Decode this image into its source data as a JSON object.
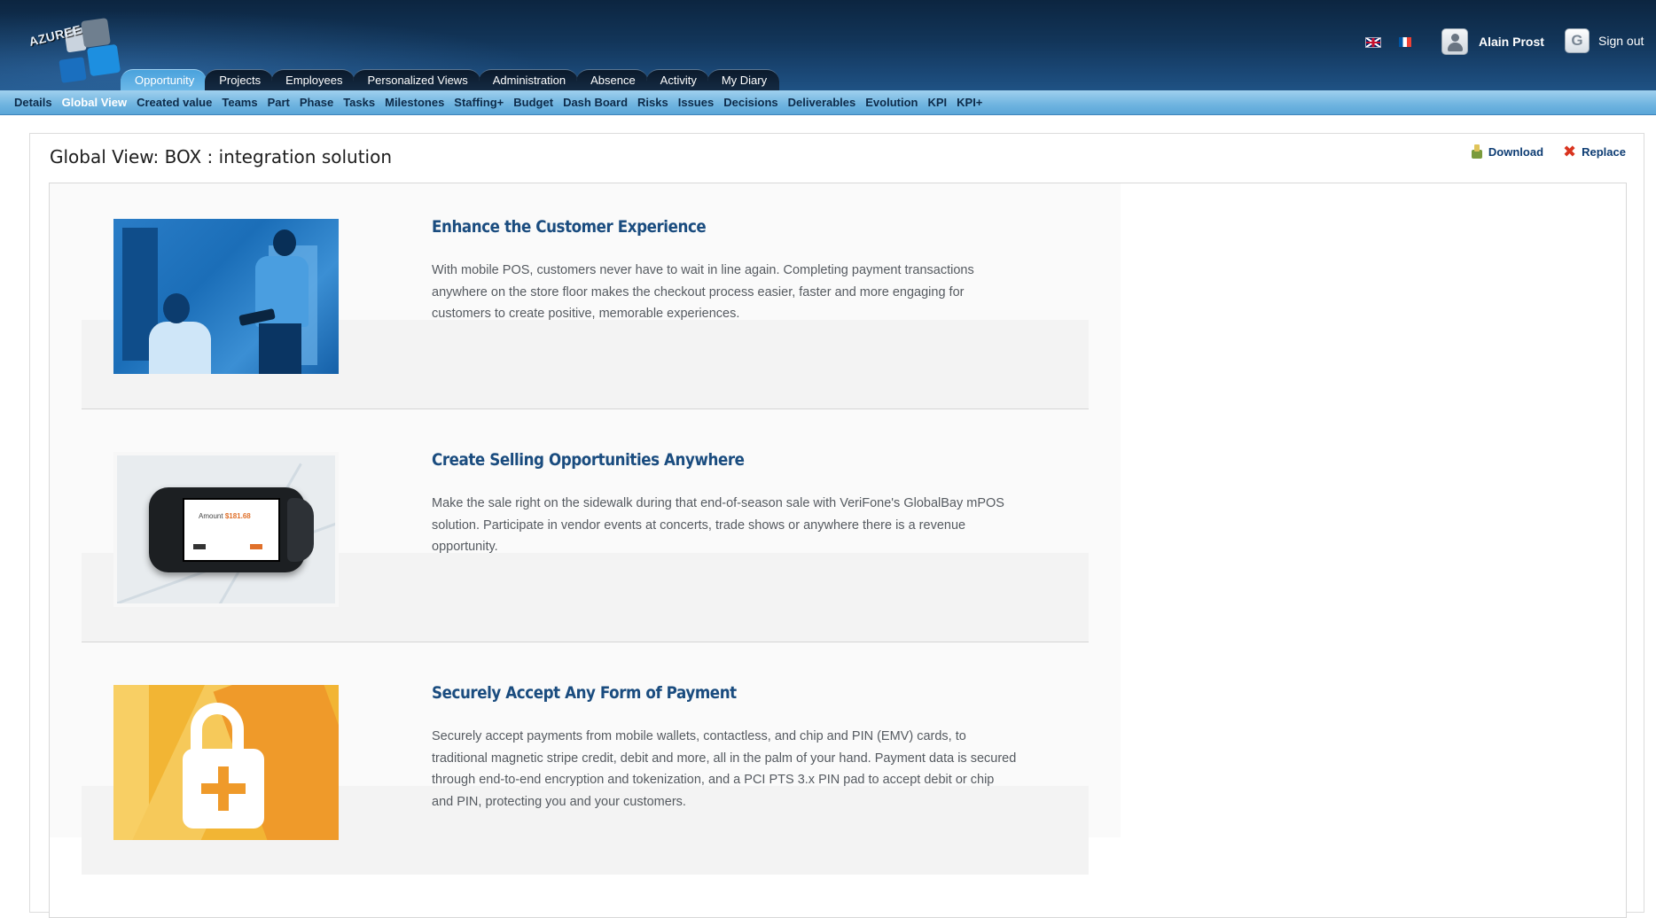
{
  "brand": {
    "logo_text": "AZUREE"
  },
  "header": {
    "languages": [
      {
        "code": "en",
        "icon": "uk-flag-icon"
      },
      {
        "code": "fr",
        "icon": "fr-flag-icon"
      }
    ],
    "user_name": "Alain Prost",
    "sign_out_label": "Sign out"
  },
  "main_tabs": [
    {
      "label": "Opportunity",
      "active": true
    },
    {
      "label": "Projects",
      "active": false
    },
    {
      "label": "Employees",
      "active": false
    },
    {
      "label": "Personalized Views",
      "active": false
    },
    {
      "label": "Administration",
      "active": false
    },
    {
      "label": "Absence",
      "active": false
    },
    {
      "label": "Activity",
      "active": false
    },
    {
      "label": "My Diary",
      "active": false
    }
  ],
  "sub_nav": [
    {
      "label": "Details",
      "active": false
    },
    {
      "label": "Global View",
      "active": true
    },
    {
      "label": "Created value",
      "active": false
    },
    {
      "label": "Teams",
      "active": false
    },
    {
      "label": "Part",
      "active": false
    },
    {
      "label": "Phase",
      "active": false
    },
    {
      "label": "Tasks",
      "active": false
    },
    {
      "label": "Milestones",
      "active": false
    },
    {
      "label": "Staffing+",
      "active": false
    },
    {
      "label": "Budget",
      "active": false
    },
    {
      "label": "Dash Board",
      "active": false
    },
    {
      "label": "Risks",
      "active": false
    },
    {
      "label": "Issues",
      "active": false
    },
    {
      "label": "Decisions",
      "active": false
    },
    {
      "label": "Deliverables",
      "active": false
    },
    {
      "label": "Evolution",
      "active": false
    },
    {
      "label": "KPI",
      "active": false
    },
    {
      "label": "KPI+",
      "active": false
    }
  ],
  "panel": {
    "title": "Global View: BOX : integration solution",
    "download_label": "Download",
    "replace_label": "Replace"
  },
  "features": [
    {
      "title": "Enhance the Customer Experience",
      "text": "With mobile POS, customers never have to wait in line again. Completing payment transactions anywhere on the store floor makes the checkout process easier, faster and more engaging for customers to create positive, memorable experiences."
    },
    {
      "title": "Create Selling Opportunities Anywhere",
      "text": "Make the sale right on the sidewalk during that end-of-season sale with VeriFone's GlobalBay mPOS solution. Participate in vendor events at concerts, trade shows or anywhere there is a revenue opportunity.",
      "device_amount_label": "Amount",
      "device_amount_value": "$181.68"
    },
    {
      "title": "Securely Accept Any Form of Payment",
      "text": "Securely accept payments from mobile wallets, contactless, and chip and PIN (EMV) cards, to traditional magnetic stripe credit, debit and more, all in the palm of your hand.  Payment data is secured through end-to-end encryption and tokenization, and a PCI PTS 3.x PIN pad to accept debit or chip and PIN, protecting you and your customers."
    }
  ],
  "colors": {
    "header_dark": "#0c2540",
    "tab_active": "#4aa2dc",
    "subnav": "#6fb4e0",
    "heading_blue": "#1a4c7f",
    "body_text": "#555a60"
  }
}
